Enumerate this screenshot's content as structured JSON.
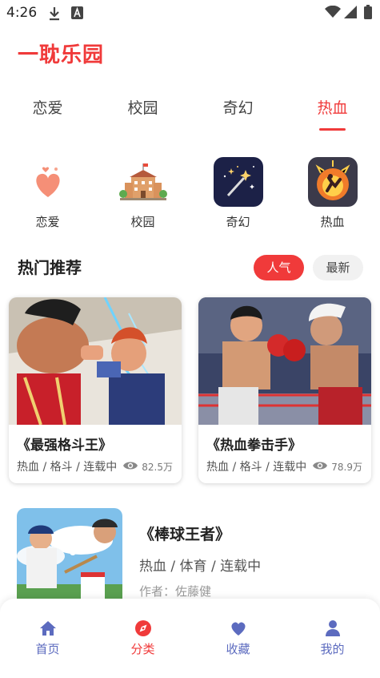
{
  "status_bar": {
    "time": "4:26"
  },
  "app": {
    "title": "一耽乐园"
  },
  "tabs": [
    {
      "label": "恋爱"
    },
    {
      "label": "校园"
    },
    {
      "label": "奇幻"
    },
    {
      "label": "热血",
      "active": true
    }
  ],
  "categories": [
    {
      "label": "恋爱",
      "icon": "heart-icon"
    },
    {
      "label": "校园",
      "icon": "school-icon"
    },
    {
      "label": "奇幻",
      "icon": "magic-wand-icon"
    },
    {
      "label": "热血",
      "icon": "fire-fighter-icon"
    }
  ],
  "section": {
    "title": "热门推荐",
    "filter_hot": "人气",
    "filter_new": "最新"
  },
  "cards": [
    {
      "title": "《最强格斗王》",
      "tags": "热血 / 格斗 / 连载中",
      "views": "82.5万"
    },
    {
      "title": "《热血拳击手》",
      "tags": "热血 / 格斗 / 连载中",
      "views": "78.9万"
    }
  ],
  "list": [
    {
      "title": "《棒球王者》",
      "tags": "热血 / 体育 / 连载中",
      "author": "作者：佐藤健"
    }
  ],
  "nav": [
    {
      "label": "首页",
      "icon": "home-icon"
    },
    {
      "label": "分类",
      "icon": "compass-icon",
      "active": true
    },
    {
      "label": "收藏",
      "icon": "heart-icon"
    },
    {
      "label": "我的",
      "icon": "user-icon"
    }
  ],
  "colors": {
    "accent": "#f03a3a",
    "nav_inactive": "#5c6bbf"
  }
}
